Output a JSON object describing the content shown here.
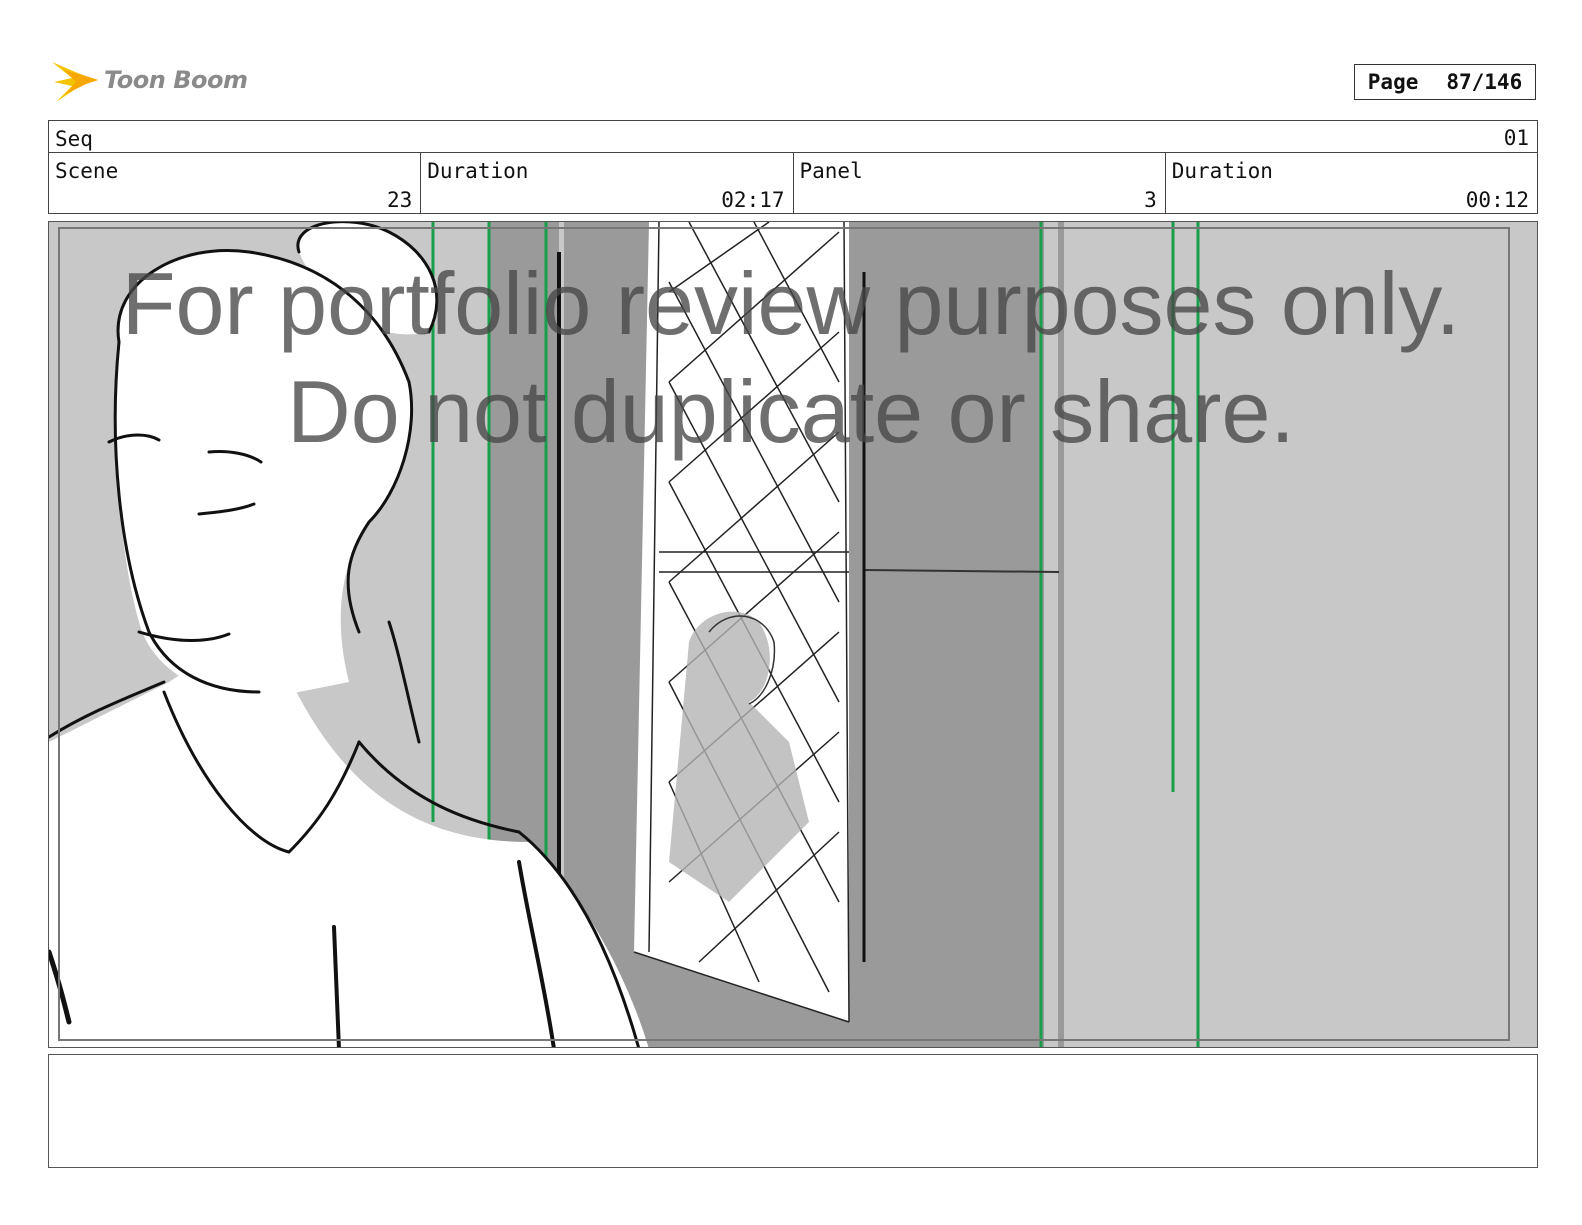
{
  "logo": {
    "brand_text": "Toon Boom",
    "icon": "toon-boom-star-icon"
  },
  "page": {
    "label": "Page",
    "number": "87/146"
  },
  "seq": {
    "label": "Seq",
    "value": "01"
  },
  "scene": {
    "label": "Scene",
    "value": "23"
  },
  "scene_duration": {
    "label": "Duration",
    "value": "02:17"
  },
  "panel": {
    "label": "Panel",
    "value": "3"
  },
  "panel_duration": {
    "label": "Duration",
    "value": "00:12"
  },
  "watermark": {
    "line1": "For portfolio review purposes only.",
    "line2": "Do not duplicate or share."
  },
  "notes": {
    "text": ""
  },
  "colors": {
    "guide_green": "#1a9e4a",
    "panel_gray": "#c8c8c8",
    "dark_gray": "#999999"
  }
}
